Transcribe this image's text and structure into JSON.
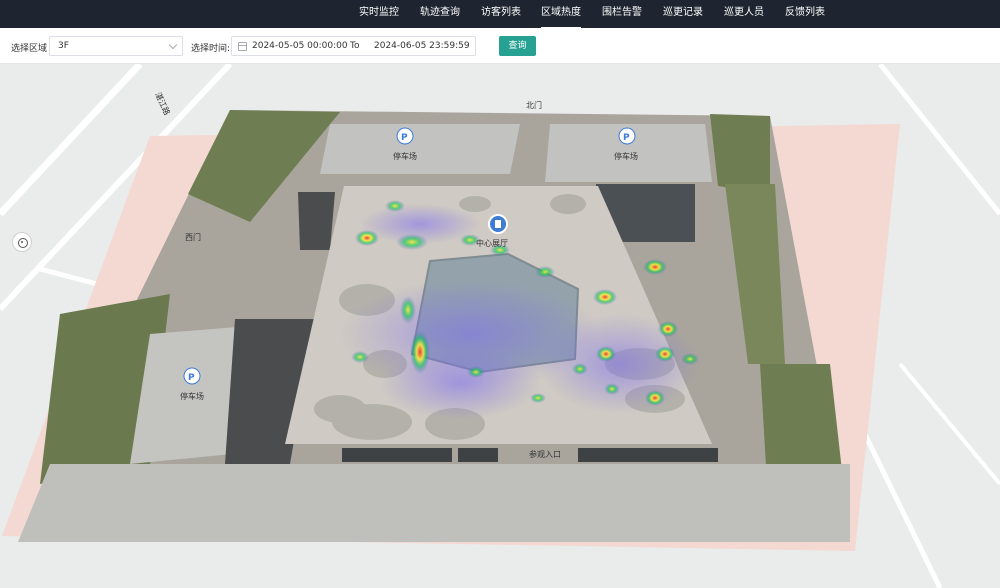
{
  "nav": {
    "tabs": [
      {
        "label": "实时监控"
      },
      {
        "label": "轨迹查询"
      },
      {
        "label": "访客列表"
      },
      {
        "label": "区域热度",
        "active": true
      },
      {
        "label": "围栏告警"
      },
      {
        "label": "巡更记录"
      },
      {
        "label": "巡更人员"
      },
      {
        "label": "反馈列表"
      }
    ]
  },
  "filters": {
    "area_label": "选择区域",
    "area_value": "3F",
    "time_label": "选择时间:",
    "start": "2024-05-05 00:00:00",
    "to_label": "To",
    "end": "2024-06-05 23:59:59",
    "query_label": "查询"
  },
  "map": {
    "road_label": "湛江路",
    "north_gate": "北门",
    "west_gate": "西门",
    "visitor_entrance": "参观入口",
    "building_label": "中心展厅",
    "parking_label": "停车场",
    "parking_icon": "parking-icon",
    "colors": {
      "heat_low": "#6a5acd",
      "heat_mid": "#00c853",
      "heat_high": "#ffeb3b",
      "heat_max": "#e53935",
      "accent": "#27a191"
    }
  }
}
